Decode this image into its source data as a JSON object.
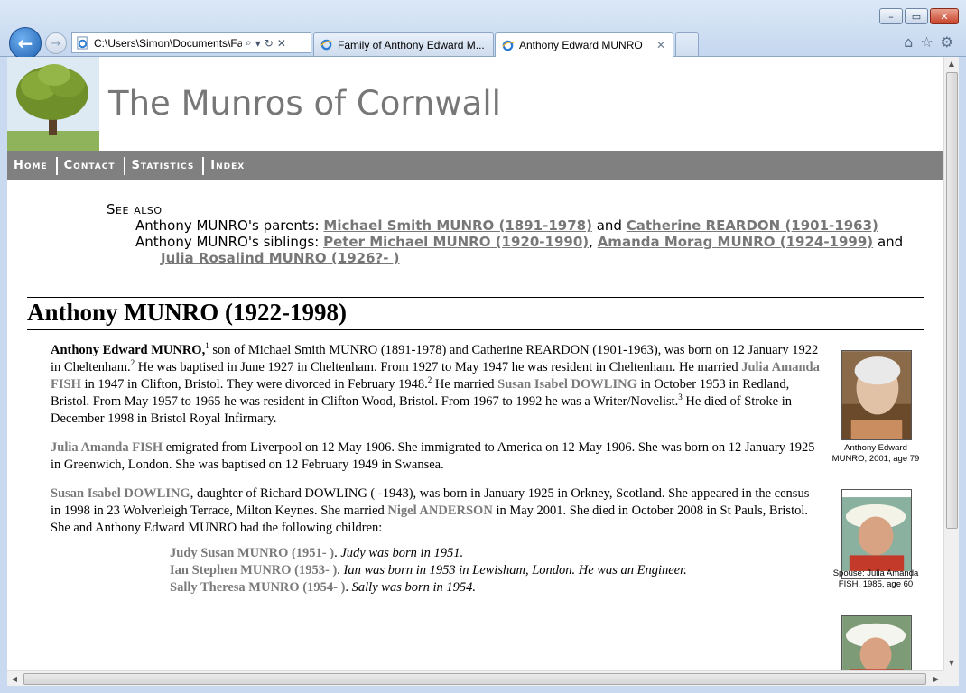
{
  "browser": {
    "address_url": "C:\\Users\\Simon\\Documents\\Fa",
    "tabs": [
      {
        "label": "Family of Anthony Edward M..."
      },
      {
        "label": "Anthony Edward MUNRO"
      }
    ],
    "window_buttons": {
      "minimize": "–",
      "maximize": "▭",
      "close": "✕"
    }
  },
  "site": {
    "title": "The Munros of Cornwall",
    "menu": [
      {
        "label": "Home"
      },
      {
        "label": "Contact"
      },
      {
        "label": "Statistics"
      },
      {
        "label": "Index"
      }
    ]
  },
  "see_also": {
    "heading": "See also",
    "parents_prefix": "Anthony MUNRO's parents:",
    "parents": [
      "Michael Smith MUNRO (1891-1978)",
      "Catherine REARDON (1901-1963)"
    ],
    "and": "and",
    "siblings_prefix": "Anthony MUNRO's siblings:",
    "siblings": [
      "Peter Michael MUNRO (1920-1990)",
      "Amanda Morag MUNRO (1924-1999)",
      "Julia Rosalind MUNRO (1926?- )"
    ],
    "comma": ","
  },
  "person": {
    "heading": "Anthony MUNRO (1922-1998)",
    "bio": {
      "name": "Anthony Edward MUNRO,",
      "sup1": "1",
      "t1": " son of Michael Smith MUNRO (1891-1978) and Catherine REARDON (1901-1963), was born on 12 January 1922 in Cheltenham.",
      "sup2": "2",
      "t2": " He was baptised in June 1927 in Cheltenham. From 1927 to May 1947 he was resident in Cheltenham. He married ",
      "spouse1": "Julia Amanda FISH",
      "t3": " in 1947 in Clifton, Bristol. They were divorced in February 1948.",
      "sup3": "2",
      "t4": " He married ",
      "spouse2": "Susan Isabel DOWLING",
      "t5": " in October 1953 in Redland, Bristol. From May 1957 to 1965 he was resident in Clifton Wood, Bristol. From 1967 to 1992 he was a Writer/Novelist.",
      "sup4": "3",
      "t6": " He died of Stroke in December 1998 in Bristol Royal Infirmary."
    },
    "spouse1_para": {
      "name": "Julia Amanda FISH",
      "text": " emigrated from Liverpool on 12 May 1906. She immigrated to America on 12 May 1906. She was born on 12 January 1925 in Greenwich, London. She was baptised on 12 February 1949 in Swansea."
    },
    "spouse2_para": {
      "name": "Susan Isabel DOWLING",
      "t1": ", daughter of Richard DOWLING ( -1943), was born in January 1925 in Orkney, Scotland. She appeared in the census in 1998 in 23 Wolverleigh Terrace, Milton Keynes. She married ",
      "partner": "Nigel ANDERSON",
      "t2": " in May 2001. She died in October 2008 in St Pauls, Bristol. She and Anthony Edward MUNRO had the following children:"
    },
    "children": [
      {
        "name": "Judy Susan MUNRO (1951- )",
        "note": "Judy was born in 1951."
      },
      {
        "name": "Ian Stephen MUNRO (1953- )",
        "note": "Ian was born in 1953 in Lewisham, London. He was an Engineer."
      },
      {
        "name": "Sally Theresa MUNRO (1954- )",
        "note": "Sally was born in 1954."
      }
    ],
    "period": ".",
    "photos": [
      {
        "caption": "Anthony Edward MUNRO, 2001, age 79"
      },
      {
        "caption": "Spouse: Julia Amanda FISH, 1985, age 60"
      }
    ]
  }
}
